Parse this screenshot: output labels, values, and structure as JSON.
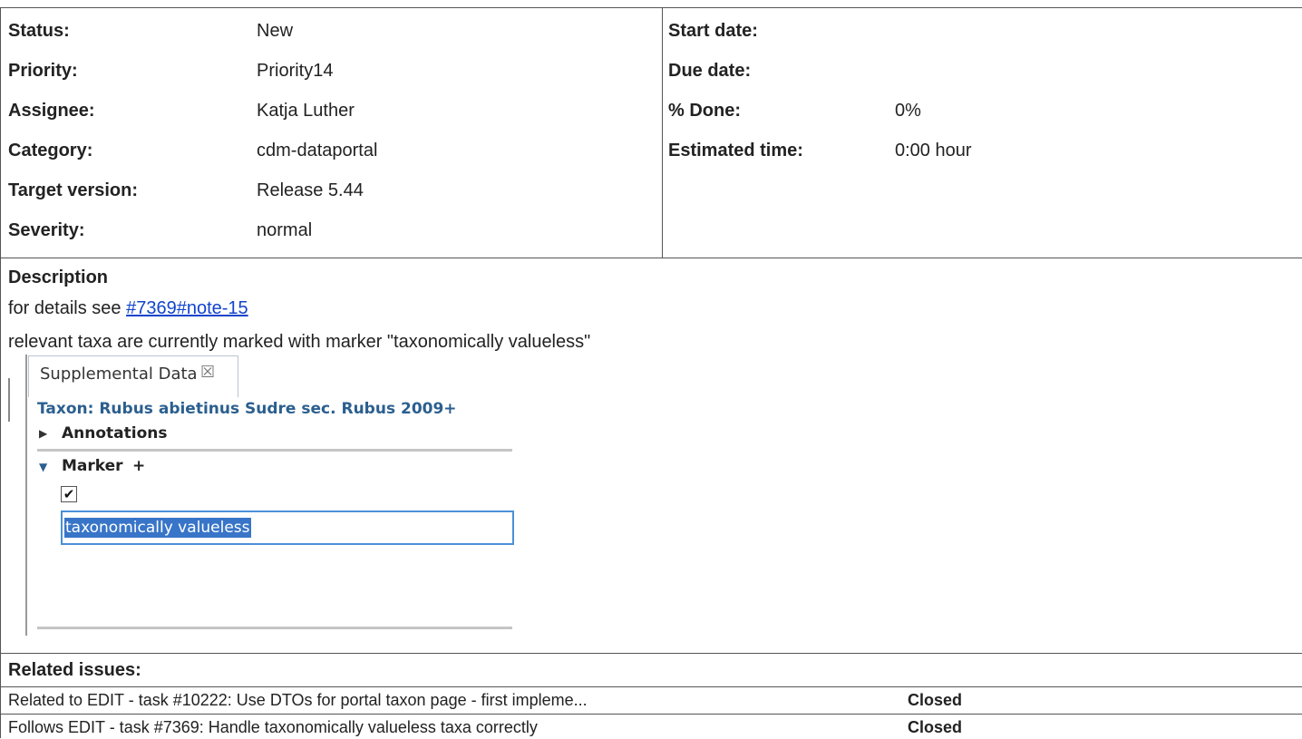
{
  "attributes_left": [
    {
      "label": "Status:",
      "value": "New"
    },
    {
      "label": "Priority:",
      "value": "Priority14"
    },
    {
      "label": "Assignee:",
      "value": "Katja Luther"
    },
    {
      "label": "Category:",
      "value": "cdm-dataportal"
    },
    {
      "label": "Target version:",
      "value": "Release 5.44"
    },
    {
      "label": "Severity:",
      "value": "normal"
    }
  ],
  "attributes_right": [
    {
      "label": "Start date:",
      "value": ""
    },
    {
      "label": "Due date:",
      "value": ""
    },
    {
      "label": "% Done:",
      "value": "0%"
    },
    {
      "label": "Estimated time:",
      "value": "0:00 hour"
    }
  ],
  "description": {
    "title": "Description",
    "line1_prefix": "for details see ",
    "line1_link": "#7369#note-15",
    "line2": "relevant taxa are currently marked with marker \"taxonomically valueless\""
  },
  "screenshot": {
    "tab_label": "Supplemental Data",
    "tab_close": "☒",
    "taxon": "Taxon: Rubus abietinus Sudre sec. Rubus 2009+",
    "annotations_label": "Annotations",
    "marker_label": "Marker",
    "marker_plus": "+",
    "checkbox_mark": "✔",
    "marker_value": "taxonomically valueless"
  },
  "related": {
    "title": "Related issues:",
    "items": [
      {
        "text": "Related to EDIT - task #10222: Use DTOs for portal taxon page - first impleme...",
        "status": "Closed"
      },
      {
        "text": "Follows EDIT - task #7369: Handle taxonomically valueless taxa correctly",
        "status": "Closed"
      }
    ]
  }
}
